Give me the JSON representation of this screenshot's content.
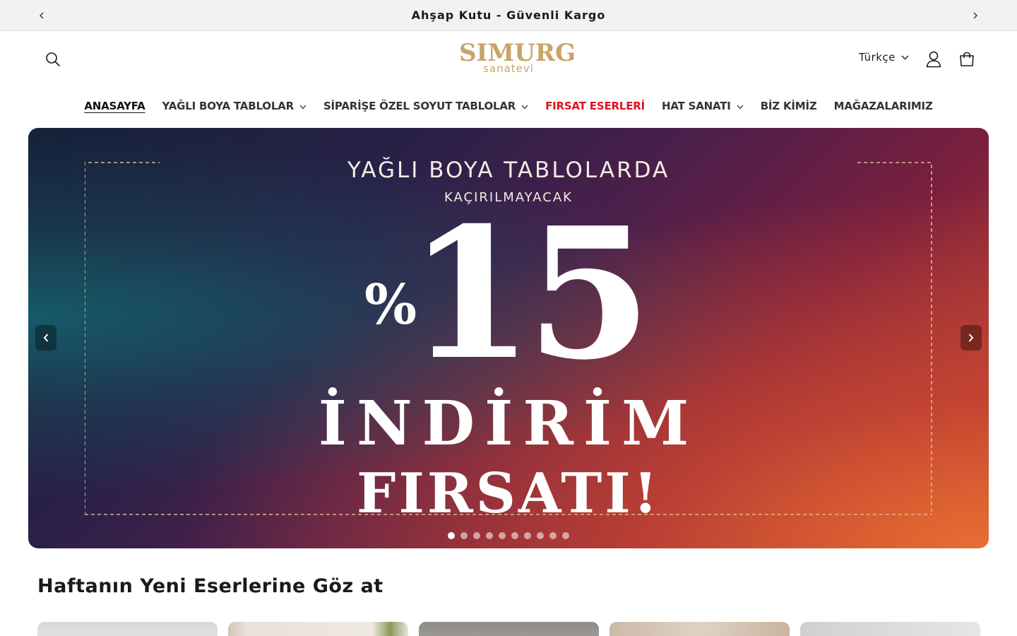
{
  "announcement": {
    "text": "Ahşap Kutu - Güvenli Kargo"
  },
  "header": {
    "logo_main": "SIMURG",
    "logo_sub": "sanatevi",
    "language": "Türkçe"
  },
  "nav": {
    "items": [
      {
        "label": "ANASAYFA",
        "dropdown": false
      },
      {
        "label": "YAĞLI BOYA TABLOLAR",
        "dropdown": true
      },
      {
        "label": "SİPARİŞE ÖZEL SOYUT TABLOLAR",
        "dropdown": true
      },
      {
        "label": "FIRSAT ESERLERİ",
        "dropdown": false
      },
      {
        "label": "HAT SANATI",
        "dropdown": true
      },
      {
        "label": "BİZ KİMİZ",
        "dropdown": false
      },
      {
        "label": "MAĞAZALARIMIZ",
        "dropdown": false
      }
    ],
    "sale_color": "#e0121b"
  },
  "hero": {
    "title": "YAĞLI BOYA TABLOLARDA",
    "subtitle": "KAÇIRILMAYACAK",
    "percent_sign": "%",
    "discount": "15",
    "line1": "İNDİRİM",
    "line2": "FIRSATI!",
    "slide_count": 10,
    "active_slide": 1
  },
  "section": {
    "title": "Haftanın Yeni Eserlerine Göz at"
  },
  "colors": {
    "brand_gold": "#c9a36a",
    "announcement_bg": "#f2f2f4",
    "text": "#121212"
  }
}
